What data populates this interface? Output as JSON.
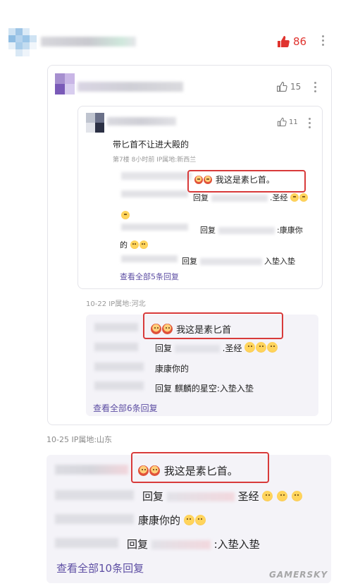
{
  "top_comment": {
    "like_count": "86",
    "ip_line": "10-25  IP属地:山东",
    "replies": {
      "r1_text": "我这是素匕首。",
      "r2_prefix": "回复",
      "r2_suffix": "圣经",
      "r3_text": "康康你的",
      "r4_prefix": "回复",
      "r4_suffix": ":入垫入垫",
      "view_all": "查看全部10条回复"
    }
  },
  "mid_comment": {
    "like_count": "15",
    "ip_line": "10-22  IP属地:河北",
    "replies": {
      "r1_text": "我这是素匕首",
      "r2_prefix": "回复",
      "r2_suffix": ".圣经",
      "r3_text": "康康你的",
      "r4_text": "回复 麒麟的星空:入垫入垫",
      "view_all": "查看全部6条回复"
    }
  },
  "inner_comment": {
    "like_count": "11",
    "content": "带匕首不让进大殿的",
    "meta": "第7楼  8小时前  IP属地:新西兰",
    "replies": {
      "r1_text": "我这是素匕首。",
      "r2_prefix": "回复",
      "r2_suffix": ".圣经",
      "r3_prefix": "回复",
      "r3_suffix": ":康康你",
      "r3_line2": "的",
      "r4_prefix": "回复",
      "r4_suffix": "入垫入垫",
      "view_all": "查看全部5条回复"
    }
  },
  "watermark": "GAMERSKY",
  "colors": {
    "like_red": "#e0342f",
    "link_purple": "#5d4ea3",
    "highlight_box": "#d83a3a"
  }
}
